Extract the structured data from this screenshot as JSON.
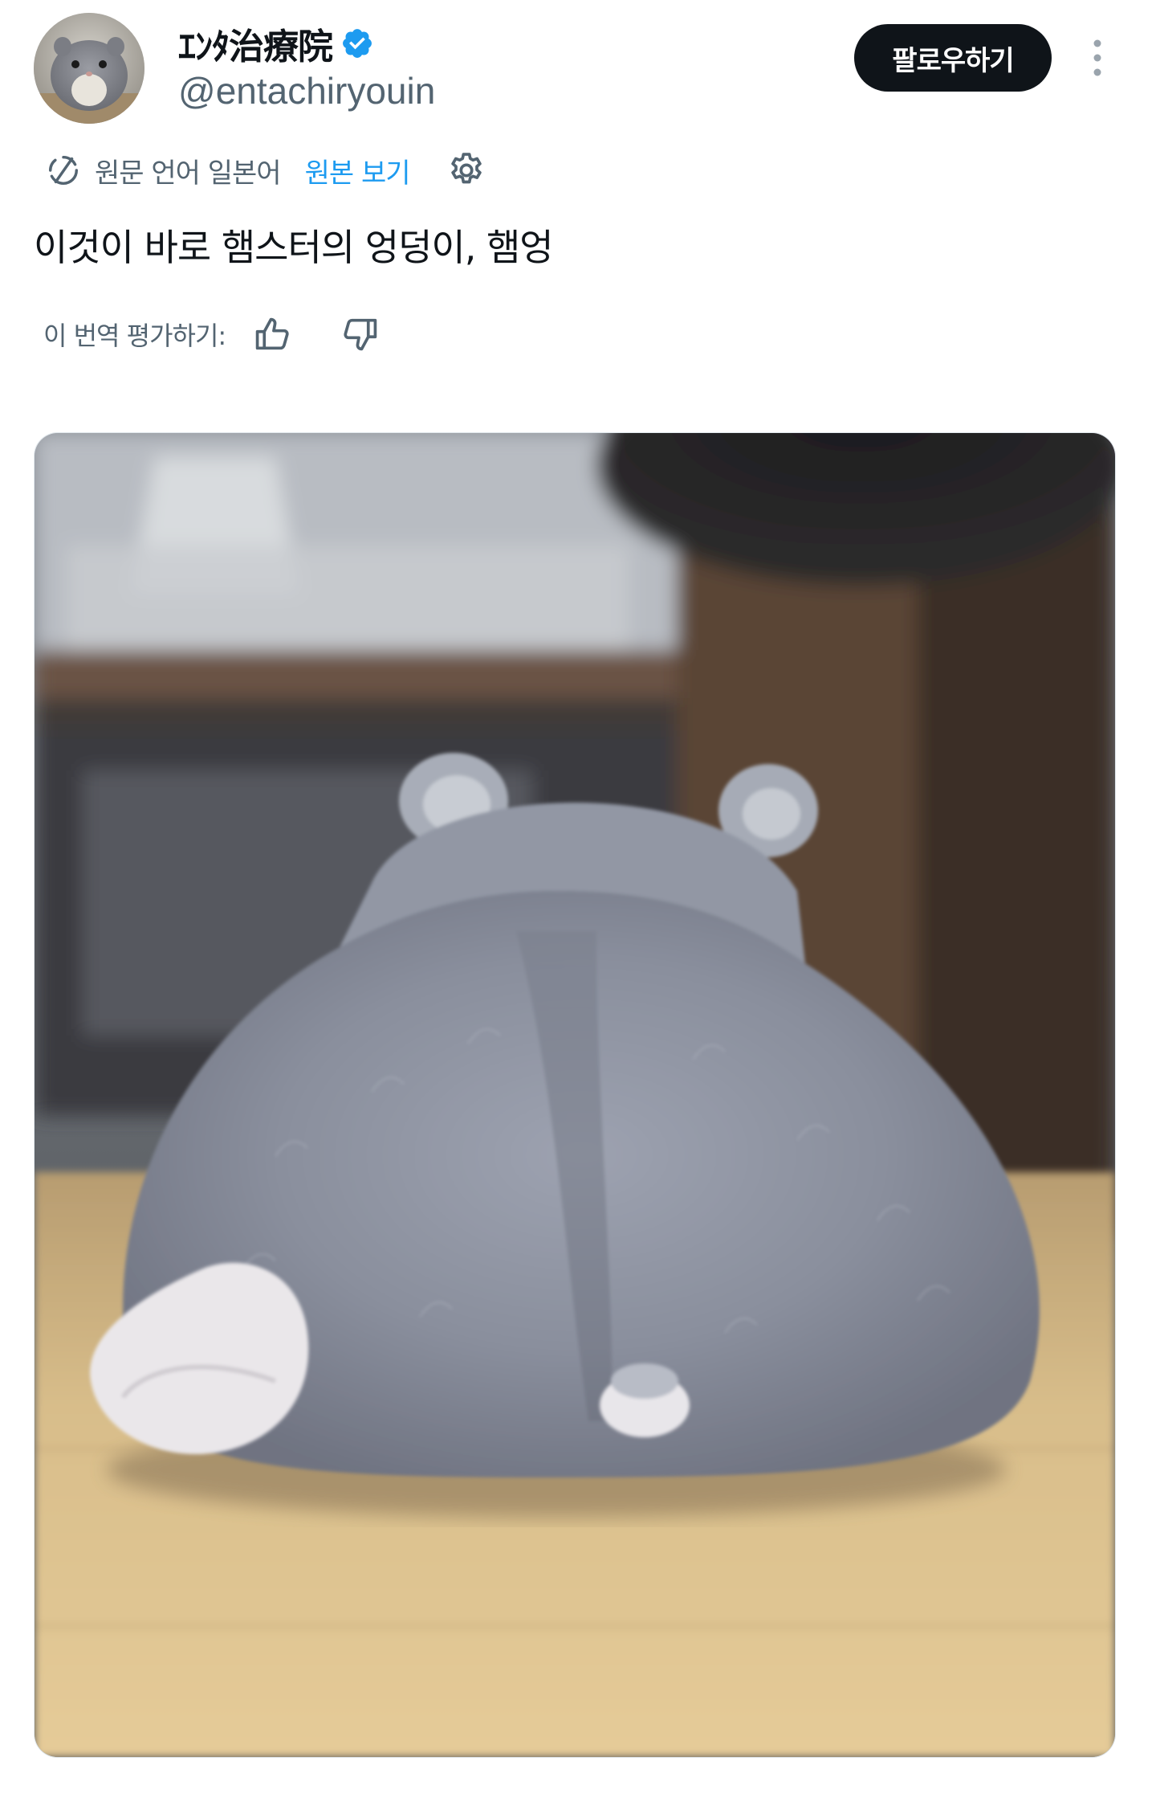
{
  "account": {
    "display_name": "ｴﾝﾀ治療院",
    "handle": "@entachiryouin",
    "avatar_alt": "hamster avatar",
    "verified": true
  },
  "header": {
    "follow_label": "팔로우하기",
    "more_icon": "more-vertical-icon"
  },
  "translation": {
    "label": "원문 언어 일본어",
    "show_original": "원본 보기",
    "icon": "translate-icon",
    "settings_icon": "gear-icon"
  },
  "tweet": {
    "text": "이것이 바로 햄스터의 엉덩이, 햄엉"
  },
  "rating": {
    "label": "이 번역 평가하기:",
    "thumbs_up_icon": "thumbs-up-icon",
    "thumbs_down_icon": "thumbs-down-icon"
  },
  "media": {
    "type": "photo",
    "subject": "gray hamster seen from behind on wooden floor"
  },
  "colors": {
    "accent": "#1d9bf0",
    "text_primary": "#0f1419",
    "text_secondary": "#536471",
    "button_bg": "#0f1419"
  }
}
